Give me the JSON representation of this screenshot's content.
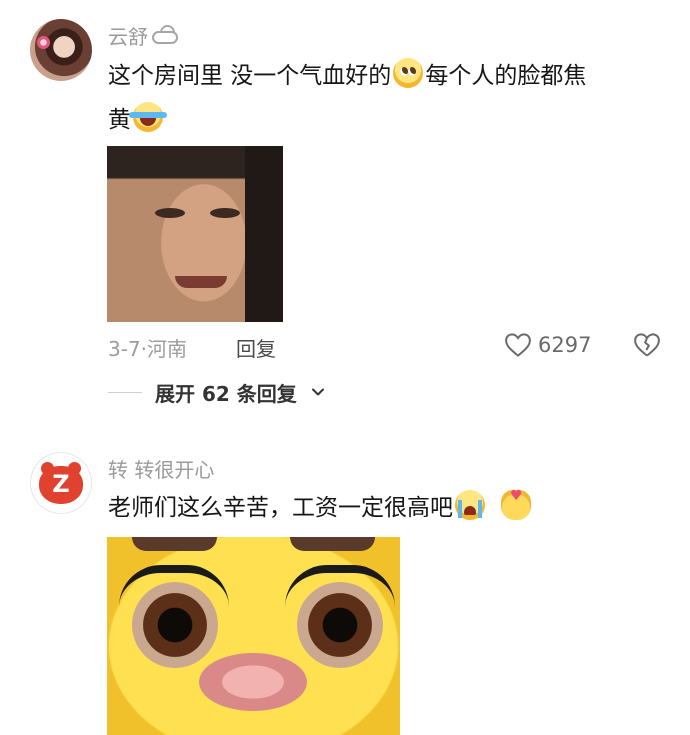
{
  "comments": [
    {
      "username": "云舒",
      "text_part1": "这个房间里 没一个气血好的",
      "text_part2": "每个人的脸都焦",
      "text_line2": "黄",
      "date": "3-7·河南",
      "reply_label": "回复",
      "like_count": "6297",
      "expand_replies_label": "展开 62 条回复"
    },
    {
      "username": "转 转很开心",
      "text": "老师们这么辛苦，工资一定很高吧"
    }
  ]
}
